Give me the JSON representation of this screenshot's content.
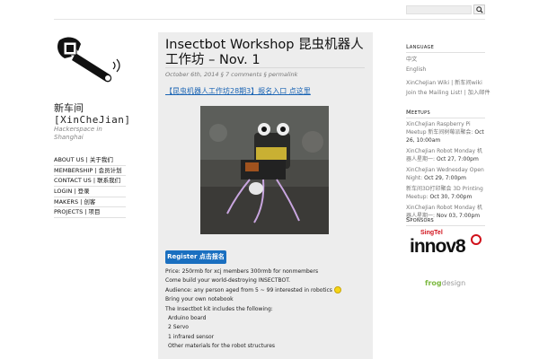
{
  "search": {
    "placeholder": ""
  },
  "site": {
    "title_cn": "新车间",
    "title_en": "[XinCheJian]",
    "tagline": "Hackerspace in Shanghai"
  },
  "nav": [
    "ABOUT US | 关于我们",
    "MEMBERSHIP | 会员计划",
    "CONTACT US | 联系我们",
    "LOGIN | 登录",
    "MAKERS | 创客",
    "PROJECTS | 项目"
  ],
  "post": {
    "title": "Insectbot Workshop 昆虫机器人工作坊 – Nov. 1",
    "meta": "October 6th, 2014 § 7 comments § permalink",
    "subtitle": "【昆虫机器人工作坊28期3】报名入口 点这里",
    "register_label": "Register 点击报名",
    "lines": [
      "Price: 250rmb for xcj members 300rmb for nonmembers",
      "Come build your world-destroying INSECTBOT.",
      "Audience: any person aged from 5 ~ 99 interested in robotics",
      "Bring your own notebook",
      "The Insectbot kit includes the following:",
      "Arduino board",
      "2 Servo",
      "1 infrared sensor",
      "Other materials for the robot structures"
    ]
  },
  "sidebar": {
    "language_head": "Language",
    "languages": [
      "中文",
      "English"
    ],
    "links": [
      "XinCheJian Wiki | 新车间wiki",
      "Join the Mailing List! | 加入邮件"
    ],
    "meetups_head": "Meetups",
    "meetups": [
      {
        "text": "XinCheJian Raspberry Pi Meetup 新车间树莓派聚会: ",
        "date": "Oct 26, 10:00am"
      },
      {
        "text": "XinCheJian Robot Monday 机器人星期一: ",
        "date": "Oct 27, 7:00pm"
      },
      {
        "text": "XinCheJian Wednesday Open Night: ",
        "date": "Oct 29, 7:00pm"
      },
      {
        "text": "新车间3D打印聚会 3D Printing Meetup: ",
        "date": "Oct 30, 7:00pm"
      },
      {
        "text": "XinCheJian Robot Monday 机器人星期一: ",
        "date": "Nov 03, 7:00pm"
      }
    ],
    "sponsors_head": "Sponsors",
    "sponsor1_top": "SingTel",
    "sponsor1_main": "innov8",
    "sponsor2_a": "frog",
    "sponsor2_b": "design"
  },
  "colors": {
    "accent": "#1a6fc0",
    "link": "#1a64b4",
    "panel": "#ededed"
  }
}
